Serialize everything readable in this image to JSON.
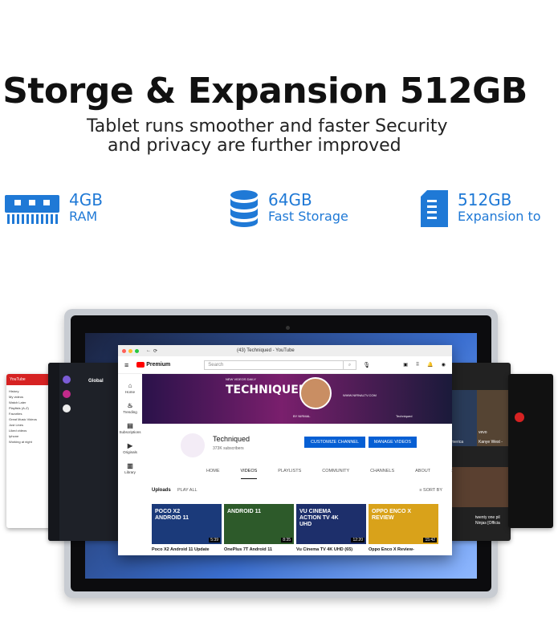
{
  "headline": "Storge & Expansion 512GB",
  "subheadline": [
    "Tablet runs smoother and faster Security",
    "and privacy are further improved"
  ],
  "features": [
    {
      "icon": "ram-chip-icon",
      "value": "4GB",
      "label": "RAM"
    },
    {
      "icon": "database-icon",
      "value": "64GB",
      "label": "Fast Storage"
    },
    {
      "icon": "sd-card-icon",
      "value": "512GB",
      "label": "Expansion to"
    }
  ],
  "colors": {
    "accent": "#1f79d6",
    "youtube_red": "#ff0000",
    "button_blue": "#065fd4"
  },
  "youtube": {
    "tab_title": "(43) Techniqued - YouTube",
    "logo": "Premium",
    "search_placeholder": "Search",
    "sidebar": [
      "Home",
      "Trending",
      "Subscriptions",
      "Originals",
      "Library"
    ],
    "banner_title": "TECHNIQUED",
    "banner_tag": "NEW VIDEOS DAILY",
    "banner_url": "WWW.NIRNALTV.COM",
    "banner_by": "BY NIRMAL",
    "banner_channel": "Techniqued",
    "channel_name": "Techniqued",
    "subscribers": "373K subscribers",
    "customize_button": "CUSTOMIZE CHANNEL",
    "manage_button": "MANAGE VIDEOS",
    "tabs": [
      "HOME",
      "VIDEOS",
      "PLAYLISTS",
      "COMMUNITY",
      "CHANNELS",
      "ABOUT"
    ],
    "active_tab": "VIDEOS",
    "uploads_label": "Uploads",
    "play_all": "PLAY ALL",
    "sort_by": "SORT BY",
    "videos": [
      {
        "title": "Poco X2 Android 11 Update",
        "thumb_text": "POCO X2 ANDROID 11",
        "duration": "5:39",
        "bg": "#1b3a7a"
      },
      {
        "title": "OnePlus 7T Android 11",
        "thumb_text": "ANDROID 11",
        "duration": "8:35",
        "bg": "#2d5a2a"
      },
      {
        "title": "Vu Cinema TV 4K UHD (65)",
        "thumb_text": "VU CINEMA ACTION TV 4K UHD",
        "duration": "12:20",
        "bg": "#1d2f6b"
      },
      {
        "title": "Oppo Enco X Review-",
        "thumb_text": "OPPO ENCO X REVIEW",
        "duration": "15:42",
        "bg": "#d9a21a"
      }
    ]
  },
  "left_cards": {
    "card1_app": "YouTube",
    "card1_items": [
      "History",
      "My videos",
      "Watch Later",
      "Playlists (A-Z)",
      "Favorites",
      "Great Music Videos",
      "Just Lines",
      "Liked videos",
      "Iphone",
      "Working at night"
    ],
    "card2_title": "Global"
  },
  "right_cards": {
    "card1_items": [
      "merica",
      "Kanye West -"
    ],
    "card1_label": "vevo",
    "card2_items": [
      "twenty one pil",
      "Ninjas [Officia"
    ]
  }
}
